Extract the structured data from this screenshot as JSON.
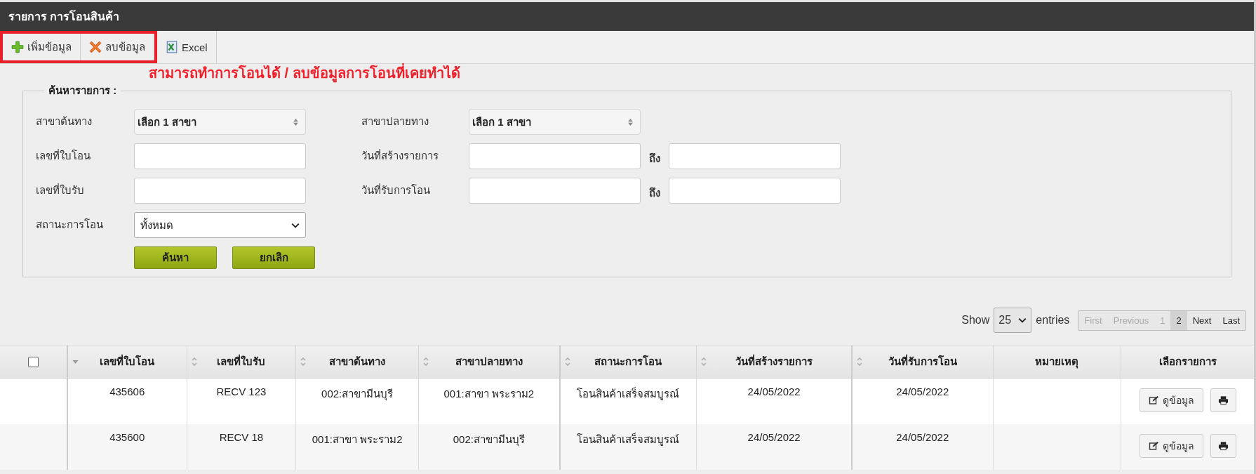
{
  "window": {
    "title": "รายการ การโอนสินค้า"
  },
  "toolbar": {
    "highlighted": true,
    "buttons": [
      {
        "kind": "add",
        "label": "เพิ่มข้อมูล"
      },
      {
        "kind": "delete",
        "label": "ลบข้อมูล"
      },
      {
        "kind": "excel",
        "label": "Excel"
      }
    ]
  },
  "annotation": "สามารถทำการโอนได้ / ลบข้อมูลการโอนที่เคยทำได้",
  "search": {
    "legend": "ค้นหารายการ :",
    "origin_branch": {
      "label": "สาขาต้นทาง",
      "value": "เลือก 1 สาขา"
    },
    "destination_branch": {
      "label": "สาขาปลายทาง",
      "value": "เลือก 1 สาขา"
    },
    "transfer_no": {
      "label": "เลขที่ใบโอน"
    },
    "created_date": {
      "label": "วันที่สร้างรายการ",
      "to": "ถึง"
    },
    "receipt_no": {
      "label": "เลขที่ใบรับ"
    },
    "received_date": {
      "label": "วันที่รับการโอน",
      "to": "ถึง"
    },
    "status": {
      "label": "สถานะการโอน",
      "value": "ทั้งหมด"
    },
    "buttons": [
      "ค้นหา",
      "ยกเลิก"
    ]
  },
  "length": {
    "show": "Show",
    "value": "25",
    "entries": "entries"
  },
  "pagination": [
    {
      "label": "First",
      "selected": false,
      "disabled": true
    },
    {
      "label": "Previous",
      "selected": false,
      "disabled": true
    },
    {
      "label": "1",
      "selected": false,
      "disabled": true
    },
    {
      "label": "2",
      "selected": true,
      "disabled": false
    },
    {
      "label": "Next",
      "selected": false,
      "disabled": false
    },
    {
      "label": "Last",
      "selected": false,
      "disabled": false
    }
  ],
  "table": {
    "select_all": {
      "checked": false
    },
    "columns": [
      {
        "label": "เลขที่ใบโอน",
        "sorted": true
      },
      {
        "label": "เลขที่ใบรับ",
        "sorted": false
      },
      {
        "label": "สาขาต้นทาง",
        "sorted": false
      },
      {
        "label": "สาขาปลายทาง",
        "sorted": false
      },
      {
        "label": "สถานะการโอน",
        "sorted": false
      },
      {
        "label": "วันที่สร้างรายการ",
        "sorted": false
      },
      {
        "label": "วันที่รับการโอน",
        "sorted": false
      },
      {
        "label": "หมายเหตุ"
      },
      {
        "label": "เลือกรายการ"
      }
    ],
    "rows": [
      {
        "cells": [
          "435606",
          "RECV 123",
          "002:สาขามีนบุรี",
          "001:สาขา พระราม2",
          "โอนสินค้าเสร็จสมบูรณ์",
          "24/05/2022",
          "24/05/2022"
        ],
        "view": "ดูข้อมูล"
      },
      {
        "cells": [
          "435600",
          "RECV 18",
          "001:สาขา พระราม2",
          "002:สาขามีนบุรี",
          "โอนสินค้าเสร็จสมบูรณ์",
          "24/05/2022",
          "24/05/2022"
        ],
        "view": "ดูข้อมูล"
      }
    ]
  }
}
